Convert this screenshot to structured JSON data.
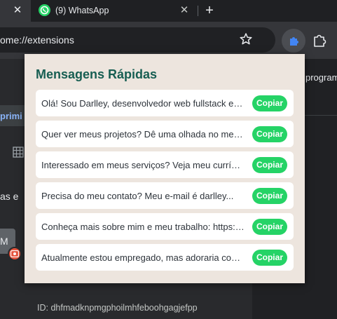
{
  "browser": {
    "whatsapp_tab_title": "(9) WhatsApp",
    "address_url": "ome://extensions",
    "new_tab_glyph": "+",
    "close_glyph": "✕"
  },
  "page": {
    "side_text": "program",
    "left_button_text": "primi",
    "left_text": "as e",
    "card_letter": "M",
    "extension_id": "ID: dhfmadknpmgphoilmhfeboohgagjefpp"
  },
  "popup": {
    "title": "Mensagens Rápidas",
    "copy_label": "Copiar",
    "messages": [
      {
        "text": "Olá! Sou Darlley, desenvolvedor web fullstack especializado em soluções modernas."
      },
      {
        "text": "Quer ver meus projetos? Dê uma olhada no meu portfólio."
      },
      {
        "text": "Interessado em meus serviços? Veja meu currículo completo."
      },
      {
        "text": "Precisa do meu contato? Meu e-mail é darlley..."
      },
      {
        "text": "Conheça mais sobre mim e meu trabalho: https://..."
      },
      {
        "text": "Atualmente estou empregado, mas adoraria conversar sobre novas oportunidades."
      }
    ]
  },
  "colors": {
    "accent_green": "#25d366",
    "title_green": "#175e52",
    "popup_bg": "#ede5de"
  },
  "icons": [
    "close-icon",
    "whatsapp-icon",
    "plus-icon",
    "star-icon",
    "extension-icon",
    "puzzle-icon",
    "grid-icon",
    "record-icon"
  ]
}
